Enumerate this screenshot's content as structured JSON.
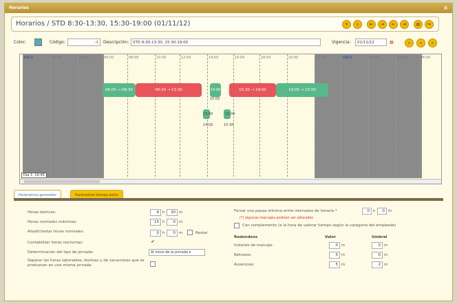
{
  "window": {
    "title": "Horarios"
  },
  "header": {
    "title": "Horarios / STD 8:30-13:30, 15:30-19:00 (01/11/12)"
  },
  "form": {
    "color_label": "Color:",
    "code_label": "Código:",
    "code_value": "-1",
    "desc_label": "Descripción:",
    "desc_value": "STD 8:30-13:30, 15:30-19:00",
    "validity_label": "Vigencia:",
    "validity_value": "01/11/12"
  },
  "timeline": {
    "day_left": "Dia 1",
    "day_right": "Dia 2",
    "day_status": "Dia 1: 10:45",
    "hours": [
      "22:00",
      "00:00",
      "04:00",
      "06:00",
      "08:00",
      "10:00",
      "12:00",
      "14:00",
      "16:00",
      "18:00",
      "20:00",
      "22:00",
      "00:00",
      "02:00",
      "04:00",
      "06:00"
    ],
    "blocks": [
      {
        "label": "06:00 → 08:30",
        "color": "#58b889"
      },
      {
        "label": "08:30 → 13:30",
        "color": "#e8545a"
      },
      {
        "label": "14:00",
        "color": "#58b889"
      },
      {
        "label": "15:30 → 19:00",
        "color": "#e8545a"
      },
      {
        "label": "19:00 → 23:00",
        "color": "#58b889"
      }
    ],
    "labels": {
      "t1500": "15:00",
      "t1300": "13:00",
      "t1500b": "15:00",
      "t1400": "14:00",
      "t1530": "15:30"
    }
  },
  "tabs": [
    "Parámetros generales",
    "Parámetros tiempo-extra"
  ],
  "general": {
    "horas_teoricas": "Horas teóricas:",
    "ht_h": "8",
    "ht_m": "30",
    "horas_max": "Horas normales máximas:",
    "hm_h": "15",
    "hm_m": "0",
    "anadir": "Añadir/restar horas normales:",
    "an_h": "0",
    "an_m": "0",
    "restar": "Restar",
    "contabilizar": "Contabilizar horas nocturnas:",
    "determinacion": "Determinación del tipo de jornada:",
    "determinacion_value": "Al inicio de la jornada",
    "separar": "Separar las horas laborables, festivas y de vacaciones que se produzcan en una misma jornada:",
    "h": "h",
    "m": "m"
  },
  "right": {
    "forzar": "Forzar una pausa mínima entre intervalos de horario *",
    "fz_h": "0",
    "fz_m": "0",
    "warning": "(*) algunos marcajes podrían ser alterados",
    "complemento": "Con complemento (a la hora de valorar tiempo según la categoría del empleado)",
    "redondeos": "Redondeos",
    "valor": "Valor",
    "umbral": "Umbral",
    "rows": [
      {
        "label": "Instante de marcaje:",
        "valor": "0",
        "umbral": "0"
      },
      {
        "label": "Retrasos:",
        "valor": "5",
        "umbral": "0"
      },
      {
        "label": "Ausencias:",
        "valor": "5",
        "umbral": "2"
      }
    ]
  }
}
